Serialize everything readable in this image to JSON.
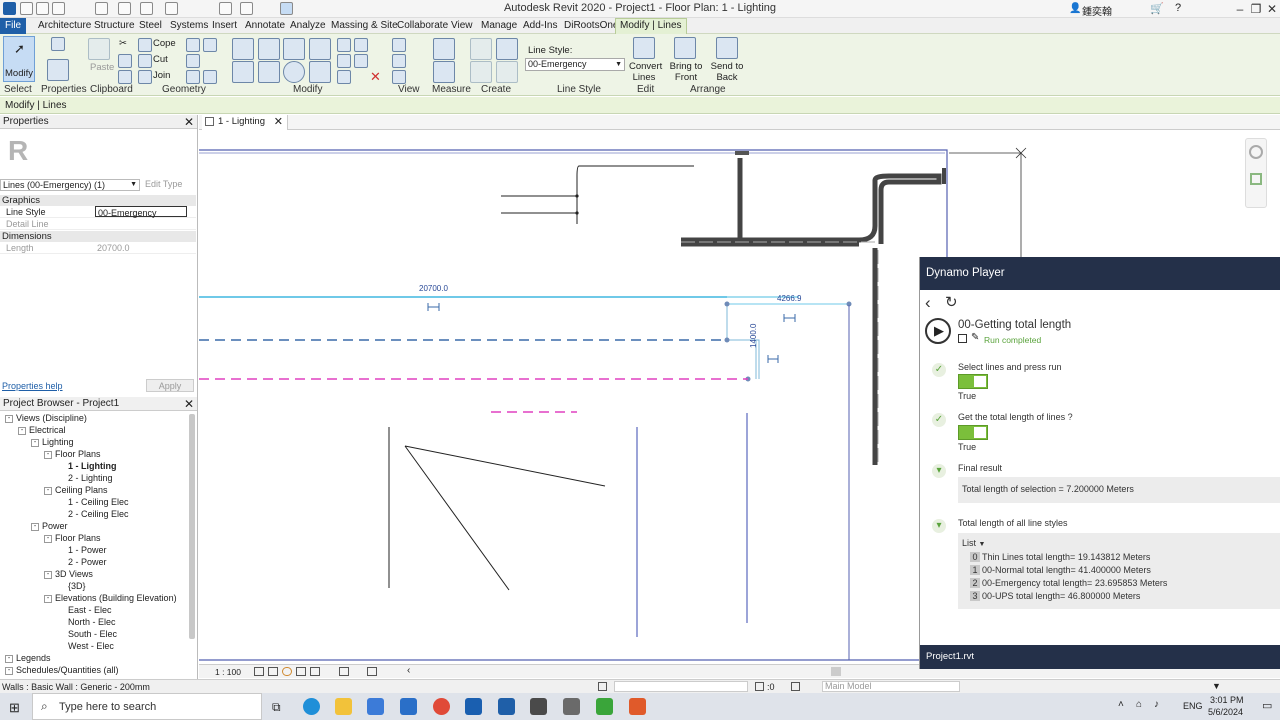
{
  "window": {
    "title": "Autodesk Revit 2020 - Project1 - Floor Plan: 1 - Lighting",
    "user": "鍾奕翰"
  },
  "ribbon": {
    "tabs": [
      "File",
      "Architecture",
      "Structure",
      "Steel",
      "Systems",
      "Insert",
      "Annotate",
      "Analyze",
      "Massing & Site",
      "Collaborate",
      "View",
      "Manage",
      "Add-Ins",
      "DiRootsOne",
      "Modify | Lines"
    ],
    "groups": {
      "select": "Select",
      "properties": "Properties",
      "clipboard": "Clipboard",
      "geometry": "Geometry",
      "modify": "Modify",
      "view": "View",
      "measure": "Measure",
      "create": "Create",
      "line_style": "Line Style",
      "edit": "Edit",
      "arrange": "Arrange"
    },
    "buttons": {
      "modify": "Modify",
      "paste": "Paste",
      "cope": "Cope",
      "cut": "Cut",
      "join": "Join",
      "line_style_label": "Line Style:",
      "line_style_value": "00-Emergency",
      "convert_lines": "Convert Lines",
      "bring_to_front": "Bring to Front",
      "send_to_back": "Send to Back"
    },
    "context": "Modify | Lines"
  },
  "properties": {
    "title": "Properties",
    "type_selector": "Lines (00-Emergency) (1)",
    "edit_type": "Edit Type",
    "categories": {
      "graphics": "Graphics",
      "dimensions": "Dimensions"
    },
    "rows": [
      {
        "key": "Line Style",
        "value": "00-Emergency"
      },
      {
        "key": "Detail Line",
        "value": ""
      },
      {
        "key": "Length",
        "value": "20700.0"
      }
    ],
    "help": "Properties help",
    "apply": "Apply"
  },
  "browser": {
    "title": "Project Browser - Project1",
    "items": [
      {
        "label": "Views (Discipline)",
        "level": 0,
        "bold": false
      },
      {
        "label": "Electrical",
        "level": 1
      },
      {
        "label": "Lighting",
        "level": 2
      },
      {
        "label": "Floor Plans",
        "level": 3
      },
      {
        "label": "1 - Lighting",
        "level": 4,
        "bold": true
      },
      {
        "label": "2 - Lighting",
        "level": 4
      },
      {
        "label": "Ceiling Plans",
        "level": 3
      },
      {
        "label": "1 - Ceiling Elec",
        "level": 4
      },
      {
        "label": "2 - Ceiling Elec",
        "level": 4
      },
      {
        "label": "Power",
        "level": 2
      },
      {
        "label": "Floor Plans",
        "level": 3
      },
      {
        "label": "1 - Power",
        "level": 4
      },
      {
        "label": "2 - Power",
        "level": 4
      },
      {
        "label": "3D Views",
        "level": 3
      },
      {
        "label": "{3D}",
        "level": 4
      },
      {
        "label": "Elevations (Building Elevation)",
        "level": 3
      },
      {
        "label": "East - Elec",
        "level": 4
      },
      {
        "label": "North - Elec",
        "level": 4
      },
      {
        "label": "South - Elec",
        "level": 4
      },
      {
        "label": "West - Elec",
        "level": 4
      },
      {
        "label": "Legends",
        "level": 0
      },
      {
        "label": "Schedules/Quantities (all)",
        "level": 0
      }
    ]
  },
  "view": {
    "tab": "1 - Lighting",
    "dim_1": "20700.0",
    "dim_2": "4266.9",
    "dim_3": "1400.0",
    "scale": "1 : 100"
  },
  "dynamo": {
    "title": "Dynamo Player",
    "script": "00-Getting total length",
    "status": "Run completed",
    "inputs": [
      {
        "label": "Select lines and press run",
        "value": "True"
      },
      {
        "label": "Get the total length of lines ?",
        "value": "True"
      }
    ],
    "final_label": "Final result",
    "final_value": "Total length of selection = 7.200000 Meters",
    "all_label": "Total length of all line styles",
    "list_label": "List",
    "list": [
      {
        "i": "0",
        "text": "Thin Lines total length= 19.143812 Meters"
      },
      {
        "i": "1",
        "text": "00-Normal total length= 41.400000 Meters"
      },
      {
        "i": "2",
        "text": "00-Emergency total length= 23.695853 Meters"
      },
      {
        "i": "3",
        "text": "00-UPS total length= 46.800000 Meters"
      }
    ],
    "footer": "Project1.rvt"
  },
  "status": {
    "left": "Walls : Basic Wall : Generic - 200mm",
    "count": ":0",
    "model": "Main Model"
  },
  "taskbar": {
    "search": "Type here to search",
    "lang": "ENG",
    "time": "3:01 PM",
    "date": "5/6/2024"
  }
}
